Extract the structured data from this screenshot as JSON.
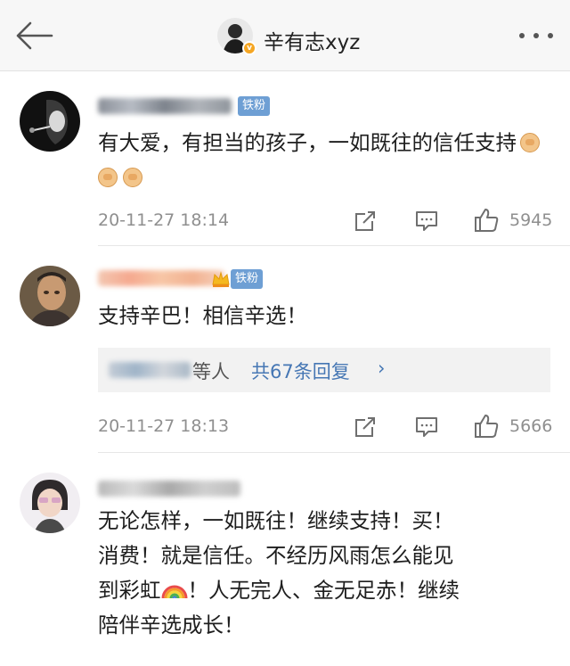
{
  "header": {
    "back_icon": "arrow-left-icon",
    "title": "辛有志xyz",
    "verified_icon": "verified-icon",
    "more_icon": "more-horizontal-icon"
  },
  "comments": [
    {
      "badge": "铁粉",
      "text": "有大爱，有担当的孩子，一如既往的信任支持",
      "emoji": [
        "fist-emoji",
        "fist-emoji",
        "fist-emoji"
      ],
      "time": "20-11-27 18:14",
      "likes": "5945"
    },
    {
      "badge": "铁粉",
      "text": "支持辛巴！相信辛选！",
      "reply_suffix": "等人",
      "reply_link": "共67条回复",
      "reply_chevron": "›",
      "time": "20-11-27 18:13",
      "likes": "5666"
    },
    {
      "text_line1": "无论怎样，一如既往！继续支持！买！",
      "text_line2": "消费！就是信任。不经历风雨怎么能见",
      "text_line3_pre": "到彩虹",
      "text_line3_post": "！人无完人、金无足赤！继续",
      "text_line4": "陪伴辛选成长！"
    }
  ],
  "icons": {
    "share": "share-icon",
    "comment": "comment-icon",
    "like": "thumbs-up-icon",
    "rainbow": "rainbow-emoji"
  },
  "colors": {
    "badge": "#6e9fd4",
    "link": "#4677b4",
    "meta": "#8f8f8f"
  }
}
